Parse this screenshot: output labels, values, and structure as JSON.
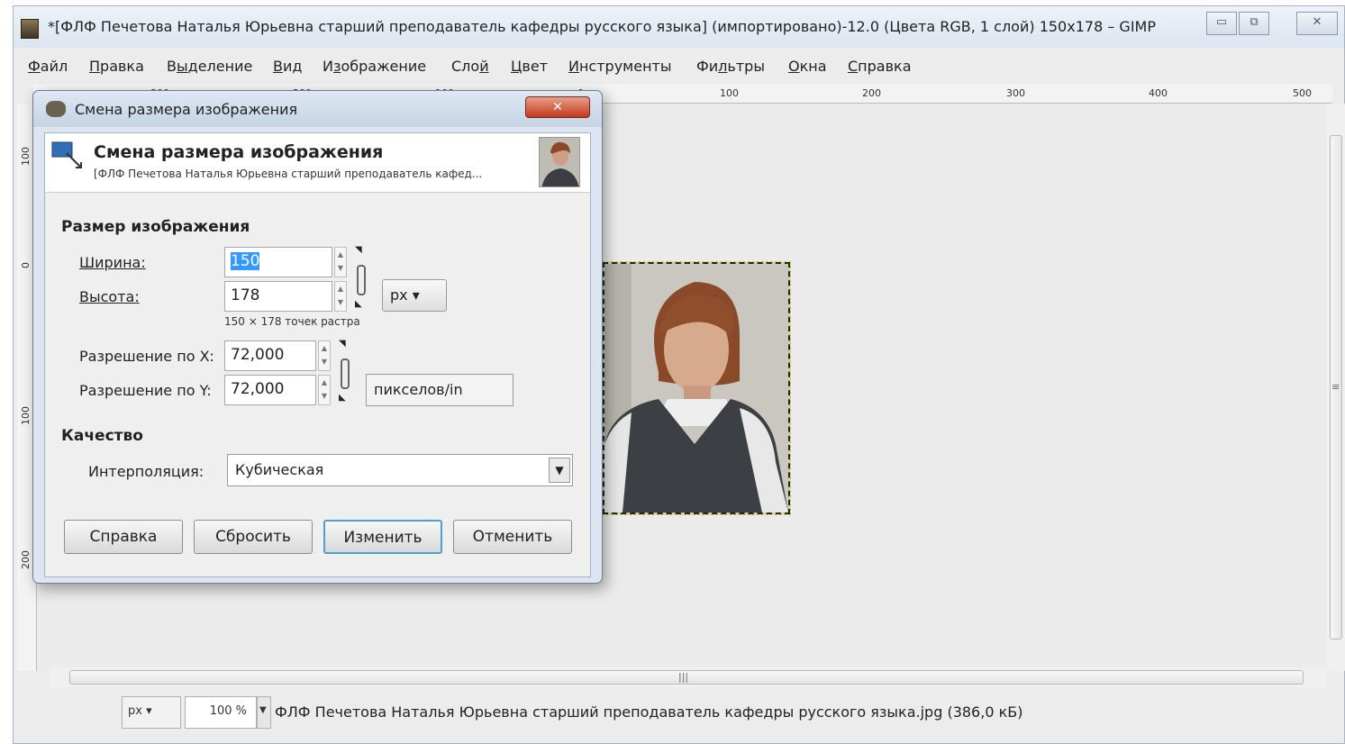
{
  "window": {
    "title": "*[ФЛФ Печетова Наталья Юрьевна старший преподаватель кафедры русского языка] (импортировано)-12.0 (Цвета RGB, 1 слой) 150x178 – GIMP",
    "minimize": "▭",
    "maximize": "⧉",
    "close": "✕"
  },
  "menubar": {
    "items": [
      {
        "pre": "",
        "u": "Ф",
        "post": "айл"
      },
      {
        "pre": "",
        "u": "П",
        "post": "равка"
      },
      {
        "pre": "В",
        "u": "ы",
        "post": "деление"
      },
      {
        "pre": "",
        "u": "В",
        "post": "ид"
      },
      {
        "pre": "И",
        "u": "з",
        "post": "ображение"
      },
      {
        "pre": "Сло",
        "u": "й",
        "post": ""
      },
      {
        "pre": "",
        "u": "Ц",
        "post": "вет"
      },
      {
        "pre": "",
        "u": "И",
        "post": "нструменты"
      },
      {
        "pre": "Фи",
        "u": "л",
        "post": "ьтры"
      },
      {
        "pre": "",
        "u": "О",
        "post": "кна"
      },
      {
        "pre": "",
        "u": "С",
        "post": "правка"
      }
    ]
  },
  "rulers": {
    "h_labels": [
      "-300",
      "-200",
      "-100",
      "0",
      "100",
      "200",
      "300",
      "400",
      "500"
    ],
    "v_labels": [
      "100",
      "0",
      "100",
      "200"
    ]
  },
  "dialog": {
    "title": "Смена размера изображения",
    "close": "✕",
    "header_title": "Смена размера изображения",
    "header_subtitle": "[ФЛФ Печетова Наталья Юрьевна старший преподаватель кафед...",
    "section_size": "Размер изображения",
    "width_label": "Ширина:",
    "width_value": "150",
    "height_label": "Высота:",
    "height_value": "178",
    "size_unit": "px",
    "pixels_info": "150 × 178 точек растра",
    "res_x_label": "Разрешение по X:",
    "res_x_value": "72,000",
    "res_y_label": "Разрешение по Y:",
    "res_y_value": "72,000",
    "res_unit": "пикселов/in",
    "section_quality": "Качество",
    "interp_label": "Интерполяция:",
    "interp_value": "Кубическая",
    "buttons": {
      "help": "Справка",
      "reset": "Сбросить",
      "apply": "Изменить",
      "cancel": "Отменить"
    }
  },
  "statusbar": {
    "unit": "px",
    "zoom": "100 %",
    "file_info": "ФЛФ Печетова Наталья Юрьевна старший преподаватель кафедры русского языка.jpg (386,0 кБ)"
  },
  "scroll": {
    "h_grip": "|||",
    "v_grip": "≡"
  },
  "colors": {
    "accent": "#4d9fd6",
    "close_button": "#c3391d",
    "selection_marching_ants": "#d8d000"
  }
}
